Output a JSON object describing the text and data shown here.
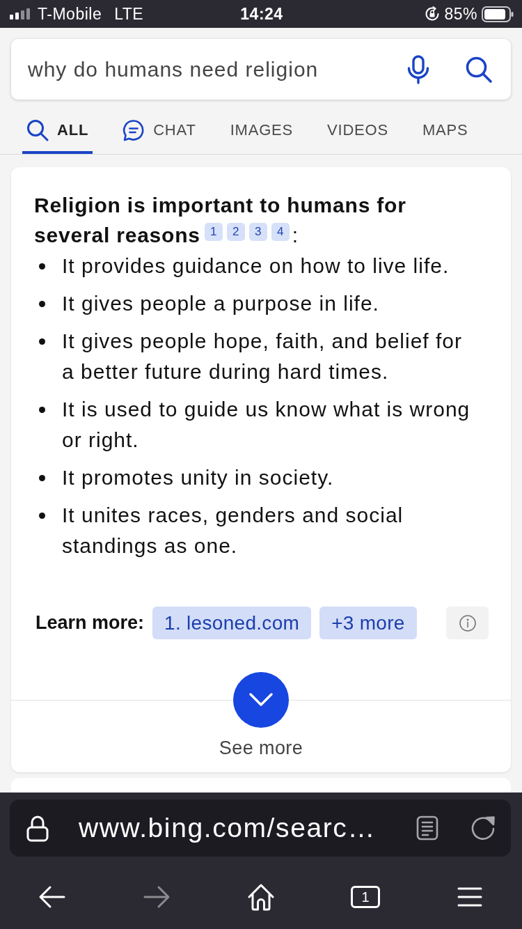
{
  "status_bar": {
    "carrier": "T-Mobile",
    "network": "LTE",
    "time": "14:24",
    "battery": "85%"
  },
  "search": {
    "value": "why do humans need religion"
  },
  "tabs": [
    {
      "label": "ALL",
      "kind": "search",
      "selected": true
    },
    {
      "label": "CHAT",
      "kind": "chat",
      "selected": false
    },
    {
      "label": "IMAGES",
      "kind": "text",
      "selected": false
    },
    {
      "label": "VIDEOS",
      "kind": "text",
      "selected": false
    },
    {
      "label": "MAPS",
      "kind": "text",
      "selected": false
    }
  ],
  "answer": {
    "heading": "Religion is important to humans for several reasons",
    "citations": [
      "1",
      "2",
      "3",
      "4"
    ],
    "heading_end": ":",
    "points": [
      "It provides guidance on how to live life.",
      "It gives people a purpose in life.",
      "It gives people hope, faith, and belief for a better future during hard times.",
      "It is used to guide us know what is wrong or right.",
      "It promotes unity in society.",
      "It unites races, genders and social standings as one."
    ],
    "learn_more": {
      "label": "Learn more:",
      "links": [
        "1. lesoned.com",
        "+3 more"
      ]
    },
    "see_more": "See more"
  },
  "browser": {
    "url": "www.bing.com/searc…",
    "nav": [
      {
        "kind": "back",
        "disabled": false
      },
      {
        "kind": "forward",
        "disabled": true
      },
      {
        "kind": "home",
        "disabled": false
      },
      {
        "kind": "tabs",
        "label": "1",
        "disabled": false
      },
      {
        "kind": "menu",
        "disabled": false
      }
    ]
  }
}
